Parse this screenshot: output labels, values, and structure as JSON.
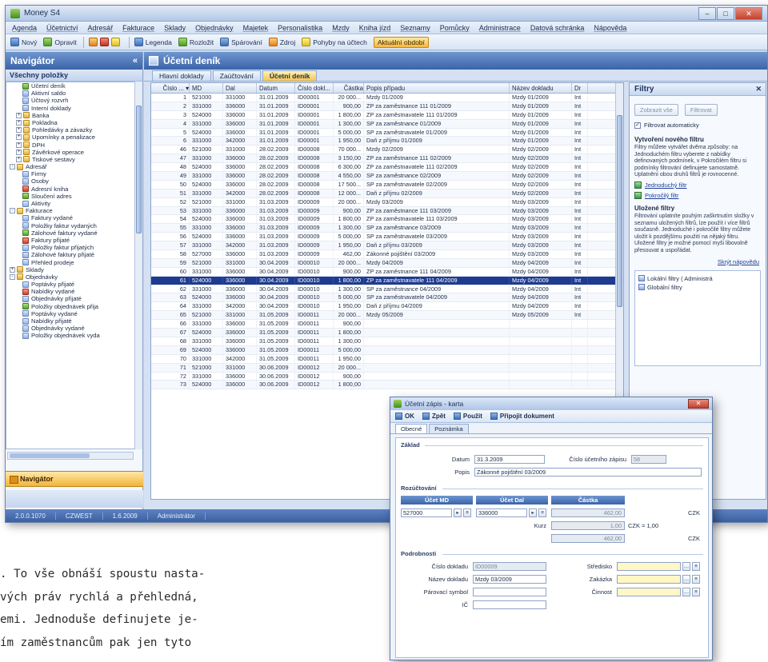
{
  "window": {
    "title": "Money S4"
  },
  "menu": [
    "Agenda",
    "Účetnictví",
    "Adresář",
    "Fakturace",
    "Sklady",
    "Objednávky",
    "Majetek",
    "Personalistika",
    "Mzdy",
    "Kniha jízd",
    "Seznamy",
    "Pomůcky",
    "Administrace",
    "Datová schránka",
    "Nápověda"
  ],
  "toolbar": {
    "items": [
      "Nový",
      "Opravit",
      "Legenda",
      "Rozložit",
      "Spárování",
      "Zdroj",
      "Pohyby na účtech"
    ],
    "badge": "Aktuální období"
  },
  "navigator": {
    "title": "Navigátor",
    "collapse": "«",
    "subtitle": "Všechny položky",
    "bottom_button": "Navigátor",
    "items": [
      {
        "label": "Účetní deník",
        "lvl": 2,
        "exp": ""
      },
      {
        "label": "Aktivní saldo",
        "lvl": 2,
        "exp": ""
      },
      {
        "label": "Účtový rozvrh",
        "lvl": 2,
        "exp": ""
      },
      {
        "label": "Interní doklady",
        "lvl": 2,
        "exp": ""
      },
      {
        "label": "Banka",
        "lvl": 1,
        "exp": "+"
      },
      {
        "label": "Pokladna",
        "lvl": 1,
        "exp": "+"
      },
      {
        "label": "Pohledávky a závazky",
        "lvl": 1,
        "exp": "+"
      },
      {
        "label": "Upomínky a penalizace",
        "lvl": 1,
        "exp": "+"
      },
      {
        "label": "DPH",
        "lvl": 1,
        "exp": "+"
      },
      {
        "label": "Závěrkové operace",
        "lvl": 1,
        "exp": "+"
      },
      {
        "label": "Tiskové sestavy",
        "lvl": 1,
        "exp": "+"
      },
      {
        "label": "Adresář",
        "lvl": 0,
        "exp": "-"
      },
      {
        "label": "Firmy",
        "lvl": 2,
        "exp": ""
      },
      {
        "label": "Osoby",
        "lvl": 2,
        "exp": ""
      },
      {
        "label": "Adresní kniha",
        "lvl": 2,
        "exp": ""
      },
      {
        "label": "Sloučení adres",
        "lvl": 2,
        "exp": ""
      },
      {
        "label": "Aktivity",
        "lvl": 2,
        "exp": ""
      },
      {
        "label": "Fakturace",
        "lvl": 0,
        "exp": "-"
      },
      {
        "label": "Faktury vydané",
        "lvl": 2,
        "exp": ""
      },
      {
        "label": "Položky faktur vydaných",
        "lvl": 2,
        "exp": ""
      },
      {
        "label": "Zálohové faktury vydané",
        "lvl": 2,
        "exp": ""
      },
      {
        "label": "Faktury přijaté",
        "lvl": 2,
        "exp": ""
      },
      {
        "label": "Položky faktur přijatých",
        "lvl": 2,
        "exp": ""
      },
      {
        "label": "Zálohové faktury přijaté",
        "lvl": 2,
        "exp": ""
      },
      {
        "label": "Přehled prodeje",
        "lvl": 2,
        "exp": ""
      },
      {
        "label": "Sklady",
        "lvl": 0,
        "exp": "+"
      },
      {
        "label": "Objednávky",
        "lvl": 0,
        "exp": "-"
      },
      {
        "label": "Poptávky přijaté",
        "lvl": 2,
        "exp": ""
      },
      {
        "label": "Nabídky vydané",
        "lvl": 2,
        "exp": ""
      },
      {
        "label": "Objednávky přijaté",
        "lvl": 2,
        "exp": ""
      },
      {
        "label": "Položky objednávek přija",
        "lvl": 2,
        "exp": ""
      },
      {
        "label": "Poptávky vydané",
        "lvl": 2,
        "exp": ""
      },
      {
        "label": "Nabídky přijaté",
        "lvl": 2,
        "exp": ""
      },
      {
        "label": "Objednávky vydané",
        "lvl": 2,
        "exp": ""
      },
      {
        "label": "Položky objednávek vyda",
        "lvl": 2,
        "exp": ""
      }
    ]
  },
  "content": {
    "title": "Účetní deník",
    "tabs": [
      "Hlavní doklady",
      "Zaúčtování",
      "Účetní deník"
    ],
    "active_tab": 2,
    "columns": [
      "Číslo ... ▾",
      "MD",
      "Dal",
      "Datum",
      "Číslo dokl...",
      "Částka",
      "Popis případu",
      "Název dokladu",
      "Dr"
    ],
    "selected_row": 21,
    "rows": [
      [
        "1",
        "521000",
        "331000",
        "31.01.2009",
        "ID00001",
        "20 000...",
        "Mzdy 01/2009",
        "Mzdy 01/2009",
        "Int"
      ],
      [
        "2",
        "331000",
        "336000",
        "31.01.2009",
        "ID00001",
        "900,00",
        "ZP za zaměstnance 111 01/2009",
        "Mzdy 01/2009",
        "Int"
      ],
      [
        "3",
        "524000",
        "336000",
        "31.01.2009",
        "ID00001",
        "1 800,00",
        "ZP za zaměstnavatele 111 01/2009",
        "Mzdy 01/2009",
        "Int"
      ],
      [
        "4",
        "331000",
        "336000",
        "31.01.2009",
        "ID00001",
        "1 300,00",
        "SP za zaměstnance 01/2009",
        "Mzdy 01/2009",
        "Int"
      ],
      [
        "5",
        "524000",
        "336000",
        "31.01.2009",
        "ID00001",
        "5 000,00",
        "SP za zaměstnavatele 01/2009",
        "Mzdy 01/2009",
        "Int"
      ],
      [
        "6",
        "331000",
        "342000",
        "31.01.2009",
        "ID00001",
        "1 950,00",
        "Daň z příjmu 01/2009",
        "Mzdy 01/2009",
        "Int"
      ],
      [
        "46",
        "521000",
        "331000",
        "28.02.2009",
        "ID00008",
        "70 000...",
        "Mzdy 02/2009",
        "Mzdy 02/2009",
        "Int"
      ],
      [
        "47",
        "331000",
        "336000",
        "28.02.2009",
        "ID00008",
        "3 150,00",
        "ZP za zaměstnance 111 02/2009",
        "Mzdy 02/2009",
        "Int"
      ],
      [
        "48",
        "524000",
        "336000",
        "28.02.2009",
        "ID00008",
        "6 300,00",
        "ZP za zaměstnavatele 111 02/2009",
        "Mzdy 02/2009",
        "Int"
      ],
      [
        "49",
        "331000",
        "336000",
        "28.02.2009",
        "ID00008",
        "4 550,00",
        "SP za zaměstnance 02/2009",
        "Mzdy 02/2009",
        "Int"
      ],
      [
        "50",
        "524000",
        "336000",
        "28.02.2009",
        "ID00008",
        "17 500...",
        "SP za zaměstnavatele 02/2009",
        "Mzdy 02/2009",
        "Int"
      ],
      [
        "51",
        "331000",
        "342000",
        "28.02.2009",
        "ID00008",
        "12 000...",
        "Daň z příjmu 02/2009",
        "Mzdy 02/2009",
        "Int"
      ],
      [
        "52",
        "521000",
        "331000",
        "31.03.2009",
        "ID00009",
        "20 000...",
        "Mzdy 03/2009",
        "Mzdy 03/2009",
        "Int"
      ],
      [
        "53",
        "331000",
        "336000",
        "31.03.2009",
        "ID00009",
        "900,00",
        "ZP za zaměstnance 111 03/2009",
        "Mzdy 03/2009",
        "Int"
      ],
      [
        "54",
        "524000",
        "336000",
        "31.03.2009",
        "ID00009",
        "1 800,00",
        "ZP za zaměstnavatele 111 03/2009",
        "Mzdy 03/2009",
        "Int"
      ],
      [
        "55",
        "331000",
        "336000",
        "31.03.2009",
        "ID00009",
        "1 300,00",
        "SP za zaměstnance 03/2009",
        "Mzdy 03/2009",
        "Int"
      ],
      [
        "56",
        "524000",
        "336000",
        "31.03.2009",
        "ID00009",
        "5 000,00",
        "SP za zaměstnavatele 03/2009",
        "Mzdy 03/2009",
        "Int"
      ],
      [
        "57",
        "331000",
        "342000",
        "31.03.2009",
        "ID00009",
        "1 950,00",
        "Daň z příjmu 03/2009",
        "Mzdy 03/2009",
        "Int"
      ],
      [
        "58",
        "527000",
        "336000",
        "31.03.2009",
        "ID00009",
        "462,00",
        "Zákonné pojištění 03/2009",
        "Mzdy 03/2009",
        "Int"
      ],
      [
        "59",
        "521000",
        "331000",
        "30.04.2009",
        "ID00010",
        "20 000...",
        "Mzdy 04/2009",
        "Mzdy 04/2009",
        "Int"
      ],
      [
        "60",
        "331000",
        "336000",
        "30.04.2009",
        "ID00010",
        "900,00",
        "ZP za zaměstnance 111 04/2009",
        "Mzdy 04/2009",
        "Int"
      ],
      [
        "61",
        "524000",
        "336000",
        "30.04.2009",
        "ID00010",
        "1 800,00",
        "ZP za zaměstnavatele 111 04/2009",
        "Mzdy 04/2009",
        "Int"
      ],
      [
        "62",
        "331000",
        "336000",
        "30.04.2009",
        "ID00010",
        "1 300,00",
        "SP za zaměstnance 04/2009",
        "Mzdy 04/2009",
        "Int"
      ],
      [
        "63",
        "524000",
        "336000",
        "30.04.2009",
        "ID00010",
        "5 000,00",
        "SP za zaměstnavatele 04/2009",
        "Mzdy 04/2009",
        "Int"
      ],
      [
        "64",
        "331000",
        "342000",
        "30.04.2009",
        "ID00010",
        "1 950,00",
        "Daň z příjmu 04/2009",
        "Mzdy 04/2009",
        "Int"
      ],
      [
        "65",
        "521000",
        "331000",
        "31.05.2009",
        "ID00011",
        "20 000...",
        "Mzdy 05/2009",
        "Mzdy 05/2009",
        "Int"
      ],
      [
        "66",
        "331000",
        "336000",
        "31.05.2009",
        "ID00011",
        "900,00",
        "",
        "",
        ""
      ],
      [
        "67",
        "524000",
        "336000",
        "31.05.2009",
        "ID00011",
        "1 800,00",
        "",
        "",
        ""
      ],
      [
        "68",
        "331000",
        "336000",
        "31.05.2009",
        "ID00011",
        "1 300,00",
        "",
        "",
        ""
      ],
      [
        "69",
        "524000",
        "336000",
        "31.05.2009",
        "ID00011",
        "5 000,00",
        "",
        "",
        ""
      ],
      [
        "70",
        "331000",
        "342000",
        "31.05.2009",
        "ID00011",
        "1 950,00",
        "",
        "",
        ""
      ],
      [
        "71",
        "521000",
        "331000",
        "30.06.2009",
        "ID00012",
        "20 000...",
        "",
        "",
        ""
      ],
      [
        "72",
        "331000",
        "336000",
        "30.06.2009",
        "ID00012",
        "900,00",
        "",
        "",
        ""
      ],
      [
        "73",
        "524000",
        "336000",
        "30.06.2009",
        "ID00012",
        "1 800,00",
        "",
        "",
        ""
      ]
    ]
  },
  "filters": {
    "title": "Filtry",
    "btn_remove": "Zobrazit vše",
    "btn_apply": "Filtrovat",
    "auto_label": "Filtrovat automaticky",
    "auto_checked": "✓",
    "new_filter_title": "Vytvoření nového filtru",
    "new_filter_text": "Filtry můžete vytvářet dvěma způsoby: na Jednoduchém filtru vyberete z nabídky definovaných podmínek, v Pokročilém filtru si podmínky filtrování definujete samostatně. Uplatnění obou druhů filtrů je rovnocenné.",
    "link_simple": "Jednoduchý filtr",
    "link_advanced": "Pokročilý filtr",
    "saved_title": "Uložené filtry",
    "saved_text": "Filtrování uplatníte pouhým zaškrtnutím složky v seznamu uložených filtrů, lze použít i více filtrů současně. Jednoduché i pokročilé filtry můžete uložit k pozdějšímu použití na nějaký filtru. Uložené filtry je možné pomocí myši libovolně přesouvat a uspořádat.",
    "link_more": "Skrýt nápovědu",
    "tree": [
      "Lokální filtry ( Administrá",
      "Globální filtry"
    ]
  },
  "statusbar": [
    "2.0.0.1070",
    "CZWEST",
    "1.6.2009",
    "Administrátor"
  ],
  "dialog": {
    "title": "Účetní zápis - karta",
    "tb": [
      "OK",
      "Zpět",
      "Použít",
      "Připojit dokument"
    ],
    "tabs": [
      "Obecné",
      "Poznámka"
    ],
    "group_basic": "Základ",
    "date_label": "Datum",
    "date_value": "31.3.2009",
    "doc_num_label": "Číslo účetního zápisu",
    "doc_num_value": "58",
    "desc_label": "Popis",
    "desc_value": "Zákonné pojištění 03/2009",
    "group_postings": "Rozúčtování",
    "col_md": "Účet MD",
    "col_dal": "Účet Dal",
    "col_amount": "Částka",
    "md_value": "527000",
    "dal_value": "336000",
    "amount_value": "462,00",
    "currency": "CZK",
    "kurz_label": "Kurz",
    "kurz_value": "1,00",
    "kurz_eq": "CZK = 1,00",
    "amount2_value": "462,00",
    "currency2": "CZK",
    "group_details": "Podrobnosti",
    "cislo_dokladu_label": "Číslo dokladu",
    "cislo_dokladu_value": "ID00009",
    "nazev_dokladu_label": "Název dokladu",
    "nazev_dokladu_value": "Mzdy 03/2009",
    "par_symbol_label": "Párovací symbol",
    "ic_label": "IČ",
    "stredisko_label": "Středisko",
    "zakazka_label": "Zakázka",
    "cinnost_label": "Činnost"
  },
  "caption": {
    "lines": [
      ". To vše obnáší spoustu nasta-",
      "vých práv rychlá a přehledná,",
      "emi. Jednoduše definujete je-",
      "ím zaměstnancům pak jen tyto"
    ]
  }
}
